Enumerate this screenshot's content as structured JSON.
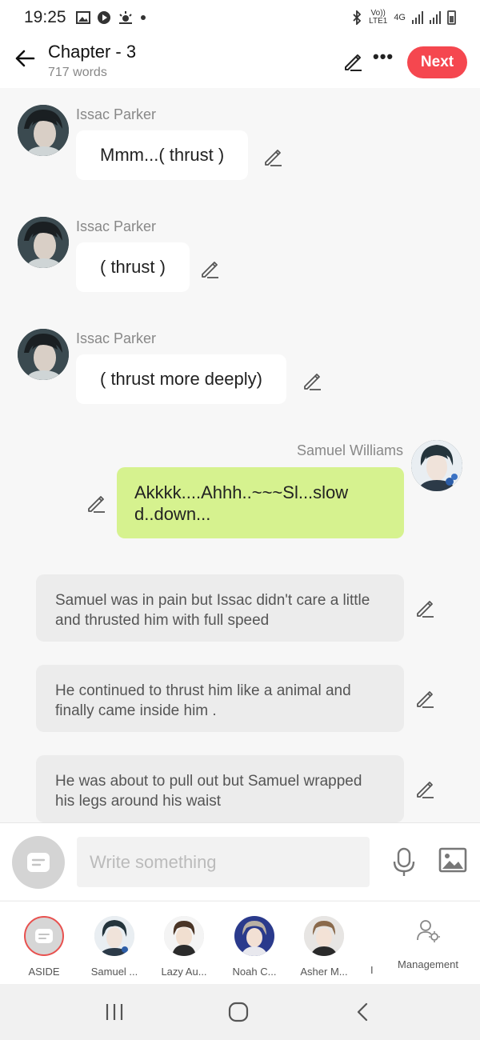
{
  "status_bar": {
    "time": "19:25",
    "network_top": "Vo))",
    "network_bottom": "LTE1",
    "network_type": "4G"
  },
  "header": {
    "title": "Chapter - 3",
    "word_count": "717 words",
    "next_label": "Next"
  },
  "messages": [
    {
      "sender": "Issac Parker",
      "text": "Mmm...( thrust )"
    },
    {
      "sender": "Issac Parker",
      "text": "( thrust )"
    },
    {
      "sender": "Issac Parker",
      "text": "( thrust more deeply)"
    }
  ],
  "reply": {
    "sender": "Samuel Williams",
    "text": "Akkkk....Ahhh..~~~Sl...slow d..down..."
  },
  "narrations": [
    "Samuel was in pain but Issac didn't care a little and thrusted him with full speed",
    "He continued to thrust him like a animal and finally came inside him .",
    "He was about to pull out but Samuel wrapped his legs around his waist"
  ],
  "input": {
    "placeholder": "Write something"
  },
  "characters": [
    {
      "label": "ASIDE"
    },
    {
      "label": "Samuel ..."
    },
    {
      "label": "Lazy Au..."
    },
    {
      "label": "Noah C..."
    },
    {
      "label": "Asher M..."
    }
  ],
  "separator": "I",
  "management_label": "Management",
  "colors": {
    "accent": "#f5474f",
    "reply_bubble": "#d6f28f",
    "narration_bg": "#ececec"
  }
}
